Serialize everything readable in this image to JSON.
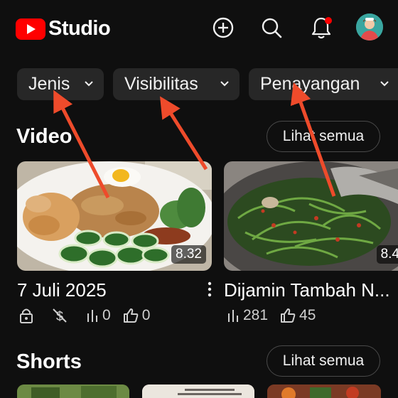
{
  "header": {
    "logo_text": "Studio",
    "icons": [
      "create-icon",
      "search-icon",
      "notification-bell-icon",
      "avatar"
    ],
    "accent": "#ff0000"
  },
  "filters": [
    {
      "label": "Jenis"
    },
    {
      "label": "Visibilitas"
    },
    {
      "label": "Penayangan"
    }
  ],
  "video_section": {
    "title": "Video",
    "see_all": "Lihat semua",
    "items": [
      {
        "duration": "8.32",
        "title": "7 Juli 2025",
        "views": "0",
        "likes": "0"
      },
      {
        "duration": "8.4",
        "title": "Dijamin Tambah N...",
        "views": "281",
        "likes": "45"
      }
    ]
  },
  "shorts_section": {
    "title": "Shorts",
    "see_all": "Lihat semua"
  }
}
